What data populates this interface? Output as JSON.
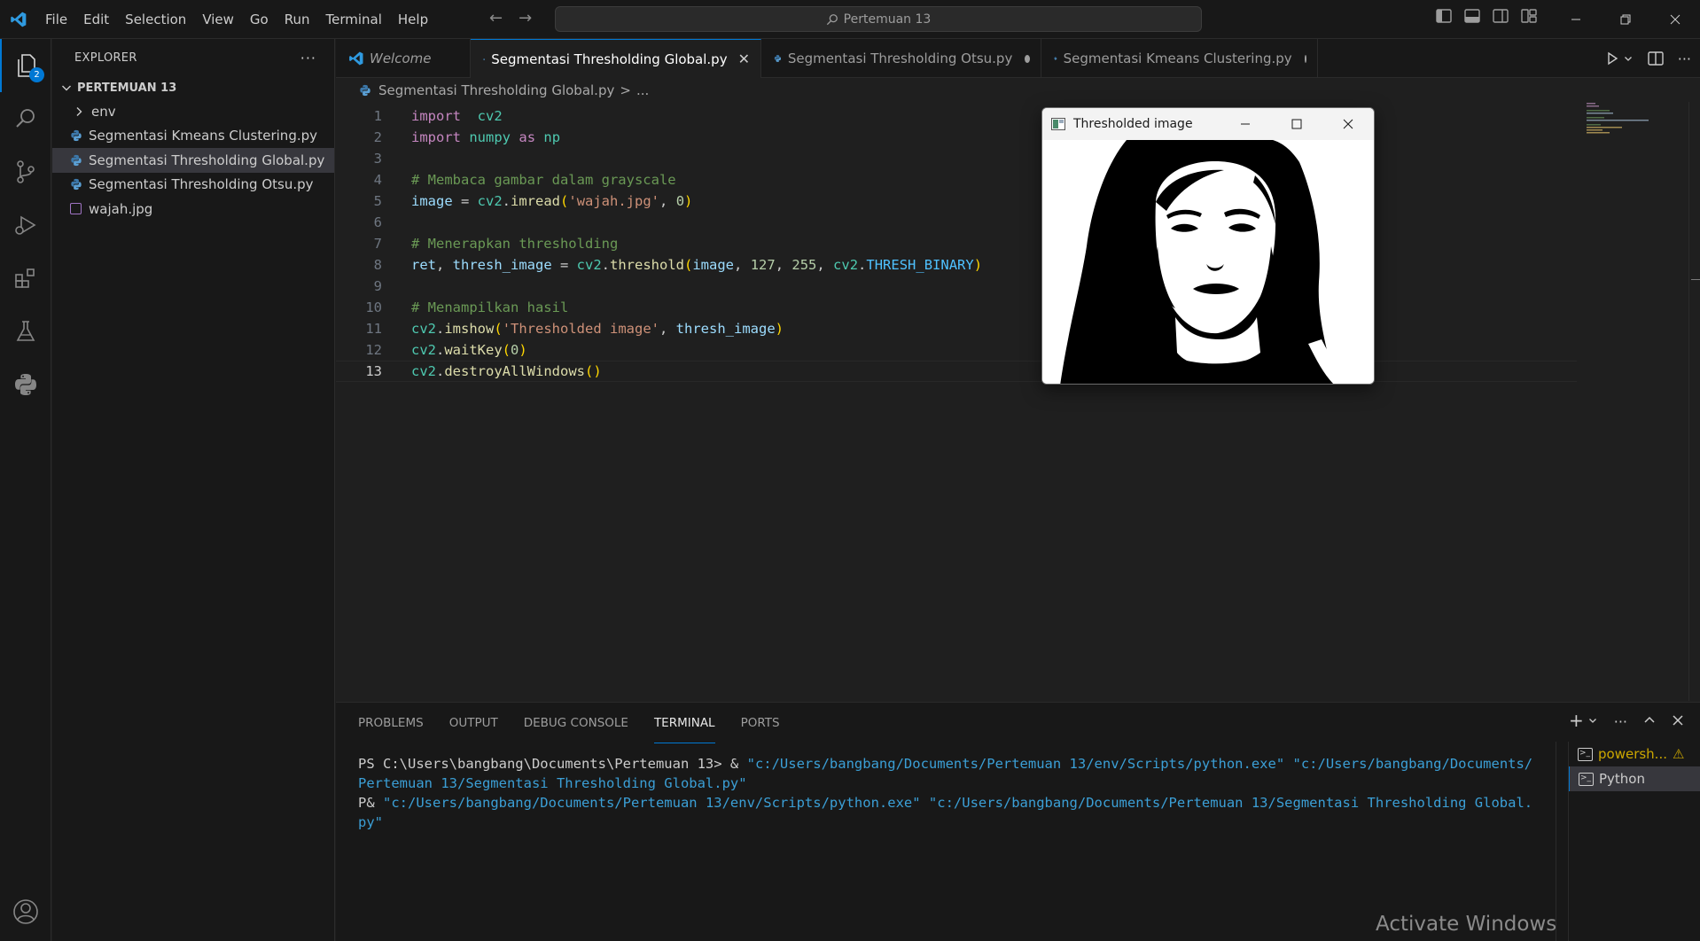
{
  "titlebar": {
    "menu": [
      "File",
      "Edit",
      "Selection",
      "View",
      "Go",
      "Run",
      "Terminal",
      "Help"
    ],
    "search_text": "Pertemuan 13",
    "icons": [
      "vscode-logo-icon",
      "back-arrow-icon",
      "forward-arrow-icon",
      "search-icon",
      "toggle-primary-sidebar-icon",
      "toggle-panel-icon",
      "toggle-secondary-sidebar-icon",
      "customize-layout-icon",
      "minimize-icon",
      "restore-icon",
      "close-icon"
    ]
  },
  "activitybar": {
    "explorer_badge": "2",
    "items": [
      "explorer-icon",
      "search-icon",
      "source-control-icon",
      "run-debug-icon",
      "extensions-icon",
      "testing-icon",
      "python-icon",
      "account-icon"
    ]
  },
  "sidebar": {
    "title": "EXPLORER",
    "folder": "PERTEMUAN 13",
    "items": [
      {
        "label": "env",
        "type": "folder"
      },
      {
        "label": "Segmentasi Kmeans Clustering.py",
        "type": "python"
      },
      {
        "label": "Segmentasi Thresholding Global.py",
        "type": "python",
        "selected": true
      },
      {
        "label": "Segmentasi Thresholding Otsu.py",
        "type": "python"
      },
      {
        "label": "wajah.jpg",
        "type": "image"
      }
    ]
  },
  "tabs": [
    {
      "label": "Welcome",
      "active": false
    },
    {
      "label": "Segmentasi Thresholding Global.py",
      "active": true
    },
    {
      "label": "Segmentasi Thresholding Otsu.py",
      "active": false,
      "dirty": true
    },
    {
      "label": "Segmentasi Kmeans Clustering.py",
      "active": false,
      "dirty": true
    }
  ],
  "breadcrumb": {
    "file": "Segmentasi Thresholding Global.py",
    "sep": ">",
    "more": "..."
  },
  "editor": {
    "current_line": 13,
    "lines": [
      [
        [
          "kw",
          "import"
        ],
        [
          "",
          "  "
        ],
        [
          "mod",
          "cv2"
        ]
      ],
      [
        [
          "kw",
          "import"
        ],
        [
          "",
          " "
        ],
        [
          "mod",
          "numpy"
        ],
        [
          "",
          " "
        ],
        [
          "kw",
          "as"
        ],
        [
          "",
          " "
        ],
        [
          "mod",
          "np"
        ]
      ],
      [],
      [
        [
          "cmt",
          "# Membaca gambar dalam grayscale"
        ]
      ],
      [
        [
          "var",
          "image"
        ],
        [
          "",
          " = "
        ],
        [
          "mod",
          "cv2"
        ],
        [
          "",
          "."
        ],
        [
          "fn",
          "imread"
        ],
        [
          "br",
          "("
        ],
        [
          "str",
          "'wajah.jpg'"
        ],
        [
          "",
          ", "
        ],
        [
          "num",
          "0"
        ],
        [
          "br",
          ")"
        ]
      ],
      [],
      [
        [
          "cmt",
          "# Menerapkan thresholding"
        ]
      ],
      [
        [
          "var",
          "ret"
        ],
        [
          "",
          ", "
        ],
        [
          "var",
          "thresh_image"
        ],
        [
          "",
          " = "
        ],
        [
          "mod",
          "cv2"
        ],
        [
          "",
          "."
        ],
        [
          "fn",
          "threshold"
        ],
        [
          "br",
          "("
        ],
        [
          "var",
          "image"
        ],
        [
          "",
          ", "
        ],
        [
          "num",
          "127"
        ],
        [
          "",
          ", "
        ],
        [
          "num",
          "255"
        ],
        [
          "",
          ", "
        ],
        [
          "mod",
          "cv2"
        ],
        [
          "",
          "."
        ],
        [
          "const",
          "THRESH_BINARY"
        ],
        [
          "br",
          ")"
        ]
      ],
      [],
      [
        [
          "cmt",
          "# Menampilkan hasil"
        ]
      ],
      [
        [
          "mod",
          "cv2"
        ],
        [
          "",
          "."
        ],
        [
          "fn",
          "imshow"
        ],
        [
          "br",
          "("
        ],
        [
          "str",
          "'Thresholded image'"
        ],
        [
          "",
          ", "
        ],
        [
          "var",
          "thresh_image"
        ],
        [
          "br",
          ")"
        ]
      ],
      [
        [
          "mod",
          "cv2"
        ],
        [
          "",
          "."
        ],
        [
          "fn",
          "waitKey"
        ],
        [
          "br",
          "("
        ],
        [
          "num",
          "0"
        ],
        [
          "br",
          ")"
        ]
      ],
      [
        [
          "mod",
          "cv2"
        ],
        [
          "",
          "."
        ],
        [
          "fn",
          "destroyAllWindows"
        ],
        [
          "br",
          "()"
        ]
      ]
    ]
  },
  "image_window": {
    "title": "Thresholded image"
  },
  "panel": {
    "tabs": [
      "PROBLEMS",
      "OUTPUT",
      "DEBUG CONSOLE",
      "TERMINAL",
      "PORTS"
    ],
    "active_tab": "TERMINAL",
    "terminal": {
      "line1_prompt": "PS C:\\Users\\bangbang\\Documents\\Pertemuan 13> & ",
      "line1_exe": "\"c:/Users/bangbang/Documents/Pertemuan 13/env/Scripts/python.exe\"",
      "line1_script": " \"c:/Users/bangbang/Documents/Pertemuan 13/Segmentasi Thresholding Global.py\"",
      "line2_prompt": "P& ",
      "line2_exe": "\"c:/Users/bangbang/Documents/Pertemuan 13/env/Scripts/python.exe\"",
      "line2_script": " \"c:/Users/bangbang/Documents/Pertemuan 13/Segmentasi Thresholding Global.py\""
    },
    "terminals": [
      {
        "label": "powersh...",
        "warning": true
      },
      {
        "label": "Python",
        "active": true
      }
    ]
  },
  "watermark": "Activate Windows",
  "colors": {
    "accent": "#0078d4",
    "background": "#1f1f1f",
    "sidebar": "#181818"
  }
}
